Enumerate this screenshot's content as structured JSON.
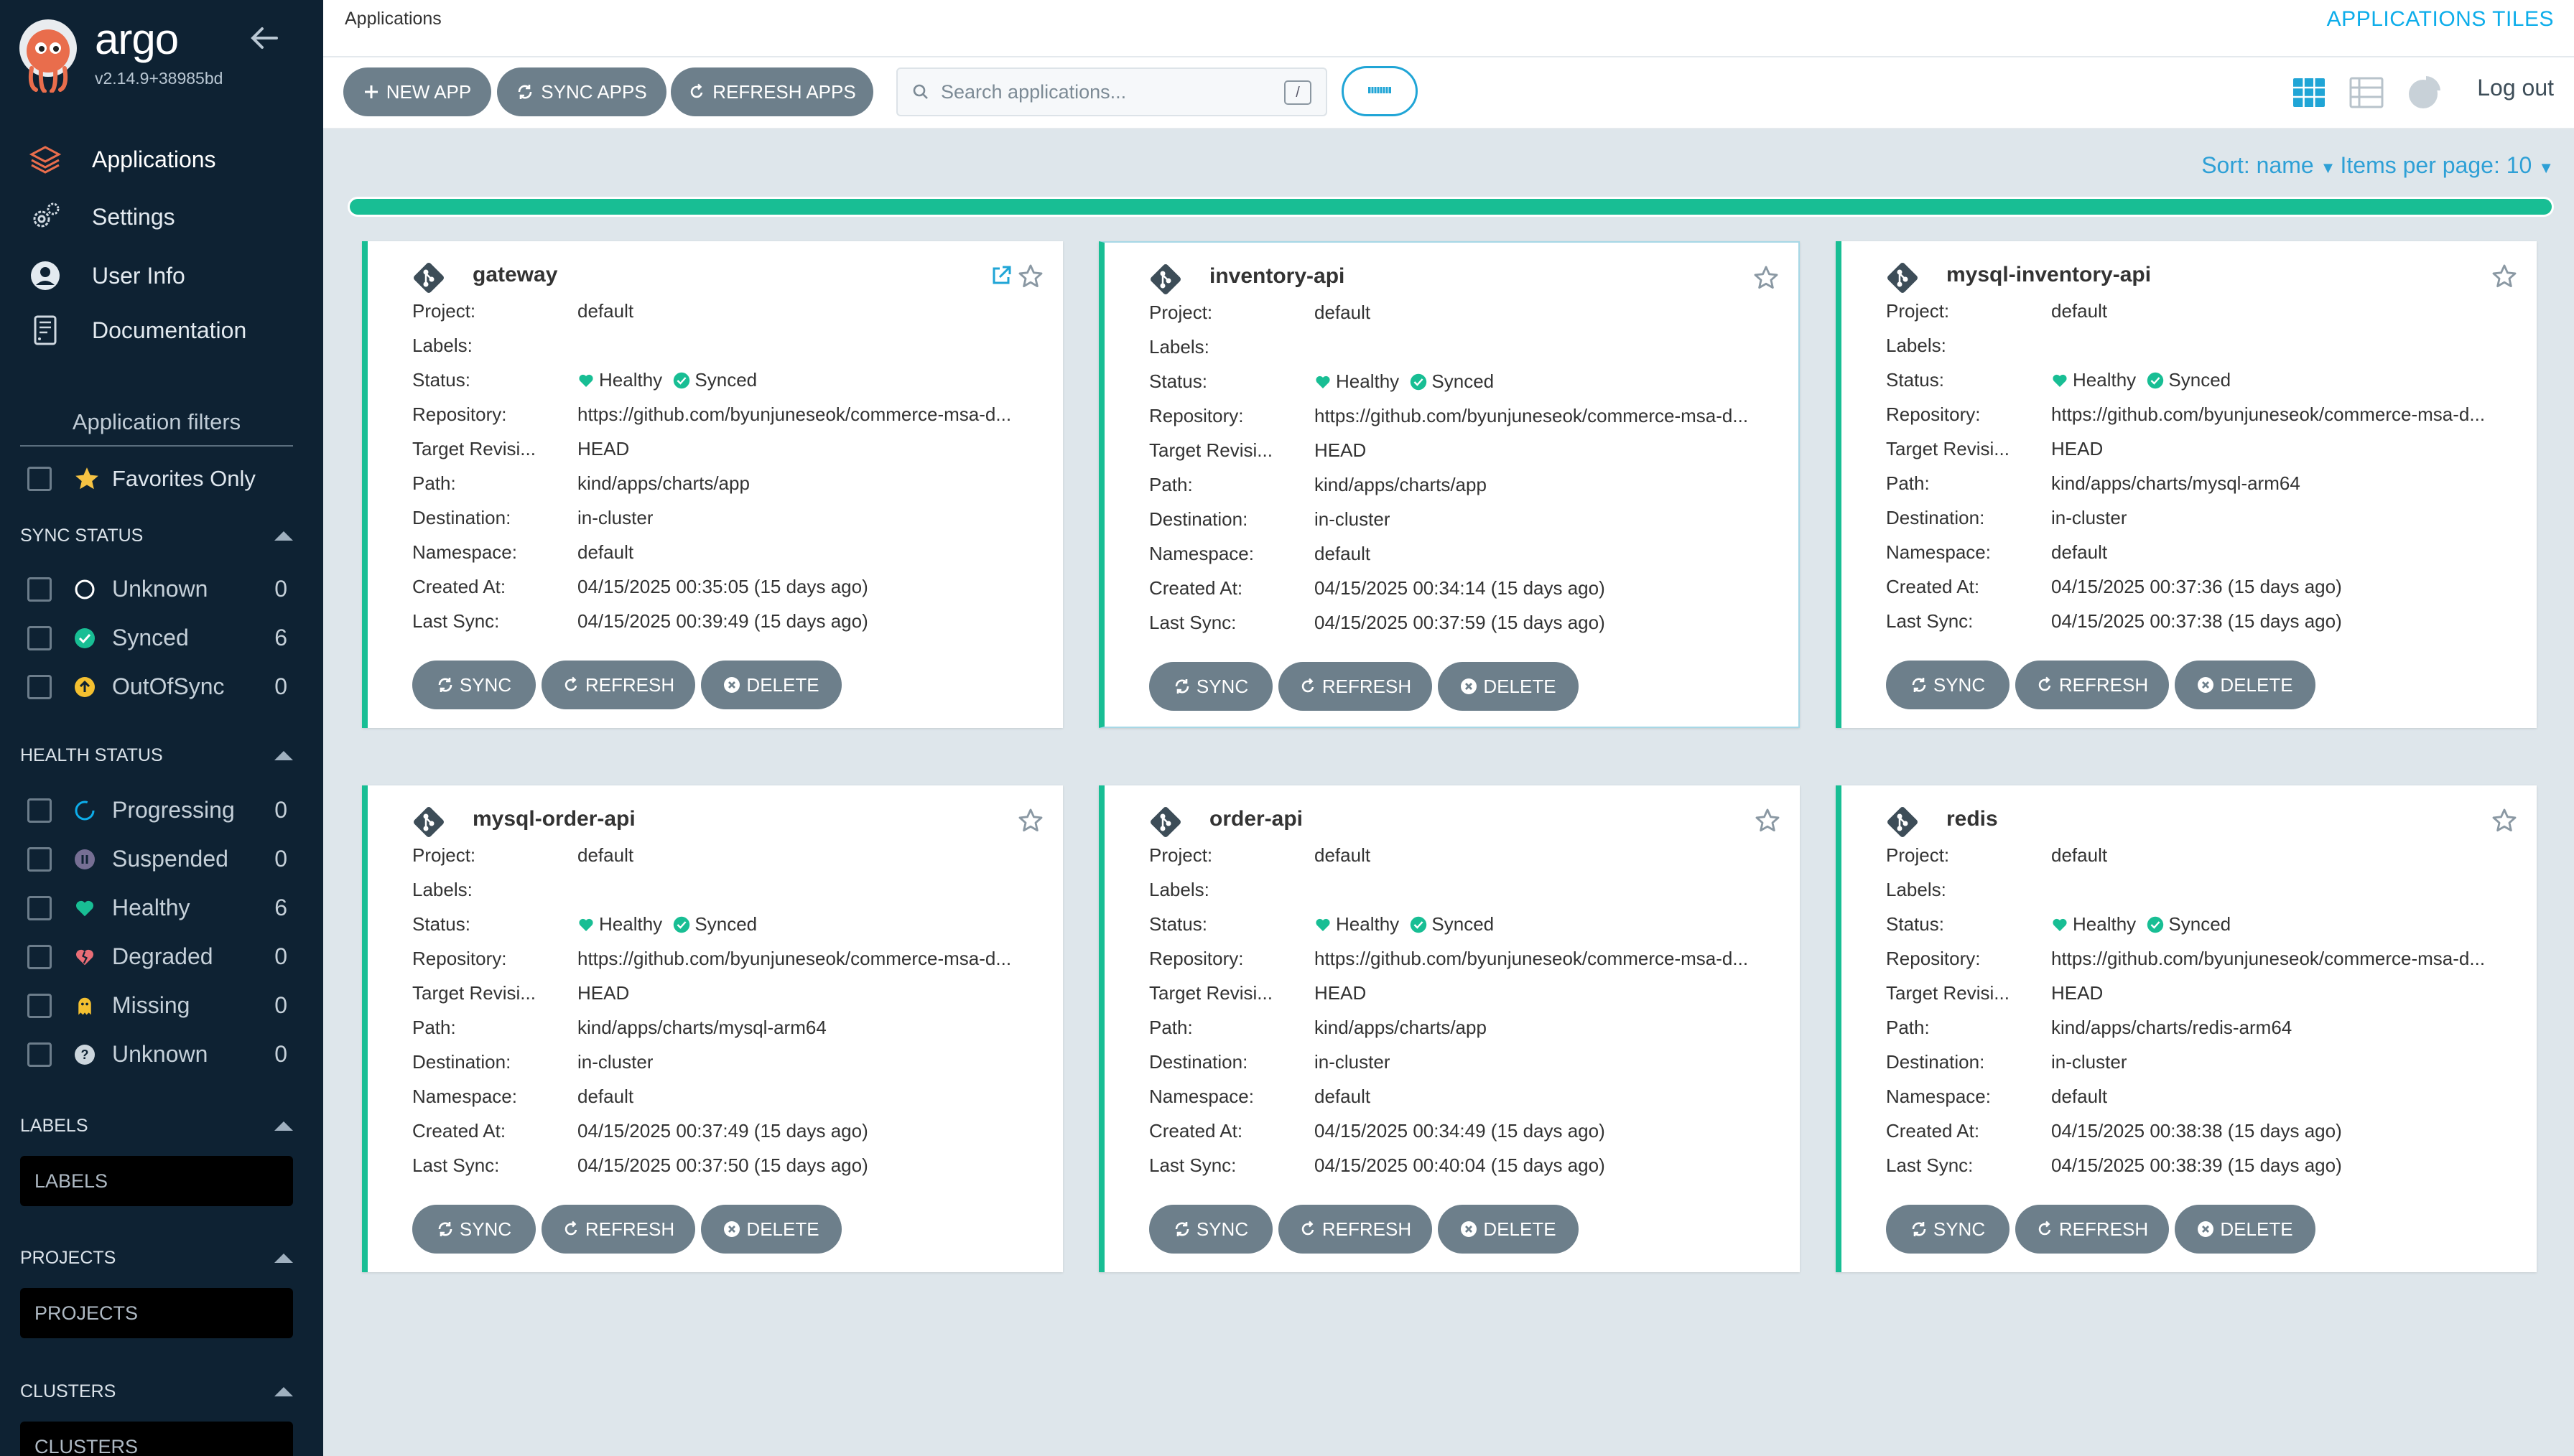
{
  "brand": {
    "name": "argo",
    "version": "v2.14.9+38985bd"
  },
  "nav": [
    {
      "label": "Applications",
      "icon": "layers-icon"
    },
    {
      "label": "Settings",
      "icon": "gears-icon"
    },
    {
      "label": "User Info",
      "icon": "user-circle-icon"
    },
    {
      "label": "Documentation",
      "icon": "book-icon"
    }
  ],
  "filters": {
    "title": "Application filters",
    "favorites_label": "Favorites Only",
    "sync_status": {
      "title": "SYNC STATUS",
      "items": [
        {
          "label": "Unknown",
          "count": "0"
        },
        {
          "label": "Synced",
          "count": "6"
        },
        {
          "label": "OutOfSync",
          "count": "0"
        }
      ]
    },
    "health_status": {
      "title": "HEALTH STATUS",
      "items": [
        {
          "label": "Progressing",
          "count": "0"
        },
        {
          "label": "Suspended",
          "count": "0"
        },
        {
          "label": "Healthy",
          "count": "6"
        },
        {
          "label": "Degraded",
          "count": "0"
        },
        {
          "label": "Missing",
          "count": "0"
        },
        {
          "label": "Unknown",
          "count": "0"
        }
      ]
    },
    "labels": {
      "title": "LABELS",
      "placeholder": "LABELS"
    },
    "projects": {
      "title": "PROJECTS",
      "placeholder": "PROJECTS"
    },
    "clusters": {
      "title": "CLUSTERS",
      "placeholder": "CLUSTERS"
    }
  },
  "header": {
    "breadcrumb": "Applications",
    "page_title": "APPLICATIONS TILES",
    "logout": "Log out"
  },
  "toolbar": {
    "new_app": "NEW APP",
    "sync_apps": "SYNC APPS",
    "refresh_apps": "REFRESH APPS",
    "search_placeholder": "Search applications...",
    "search_shortcut": "/"
  },
  "sort": {
    "text": "Sort: name",
    "items_per_page": "Items per page: 10"
  },
  "progress_fraction": 1.0,
  "field_labels": {
    "project": "Project:",
    "labels": "Labels:",
    "status": "Status:",
    "repository": "Repository:",
    "target": "Target Revisi...",
    "path": "Path:",
    "destination": "Destination:",
    "namespace": "Namespace:",
    "created": "Created At:",
    "last_sync": "Last Sync:"
  },
  "status_text": {
    "health": "Healthy",
    "sync": "Synced"
  },
  "buttons": {
    "sync": "SYNC",
    "refresh": "REFRESH",
    "delete": "DELETE"
  },
  "apps": [
    {
      "name": "gateway",
      "project": "default",
      "labels": "",
      "repository": "https://github.com/byunjuneseok/commerce-msa-d...",
      "target": "HEAD",
      "path": "kind/apps/charts/app",
      "destination": "in-cluster",
      "namespace": "default",
      "created": "04/15/2025 00:35:05  (15 days ago)",
      "last_sync": "04/15/2025 00:39:49  (15 days ago)"
    },
    {
      "name": "inventory-api",
      "project": "default",
      "labels": "",
      "repository": "https://github.com/byunjuneseok/commerce-msa-d...",
      "target": "HEAD",
      "path": "kind/apps/charts/app",
      "destination": "in-cluster",
      "namespace": "default",
      "created": "04/15/2025 00:34:14  (15 days ago)",
      "last_sync": "04/15/2025 00:37:59  (15 days ago)"
    },
    {
      "name": "mysql-inventory-api",
      "project": "default",
      "labels": "",
      "repository": "https://github.com/byunjuneseok/commerce-msa-d...",
      "target": "HEAD",
      "path": "kind/apps/charts/mysql-arm64",
      "destination": "in-cluster",
      "namespace": "default",
      "created": "04/15/2025 00:37:36  (15 days ago)",
      "last_sync": "04/15/2025 00:37:38  (15 days ago)"
    },
    {
      "name": "mysql-order-api",
      "project": "default",
      "labels": "",
      "repository": "https://github.com/byunjuneseok/commerce-msa-d...",
      "target": "HEAD",
      "path": "kind/apps/charts/mysql-arm64",
      "destination": "in-cluster",
      "namespace": "default",
      "created": "04/15/2025 00:37:49  (15 days ago)",
      "last_sync": "04/15/2025 00:37:50  (15 days ago)"
    },
    {
      "name": "order-api",
      "project": "default",
      "labels": "",
      "repository": "https://github.com/byunjuneseok/commerce-msa-d...",
      "target": "HEAD",
      "path": "kind/apps/charts/app",
      "destination": "in-cluster",
      "namespace": "default",
      "created": "04/15/2025 00:34:49  (15 days ago)",
      "last_sync": "04/15/2025 00:40:04  (15 days ago)"
    },
    {
      "name": "redis",
      "project": "default",
      "labels": "",
      "repository": "https://github.com/byunjuneseok/commerce-msa-d...",
      "target": "HEAD",
      "path": "kind/apps/charts/redis-arm64",
      "destination": "in-cluster",
      "namespace": "default",
      "created": "04/15/2025 00:38:38  (15 days ago)",
      "last_sync": "04/15/2025 00:38:39  (15 days ago)"
    }
  ],
  "colors": {
    "sidebar": "#0e2233",
    "healthy": "#18be94",
    "accent": "#0dadea",
    "button": "#6d7f8b"
  }
}
